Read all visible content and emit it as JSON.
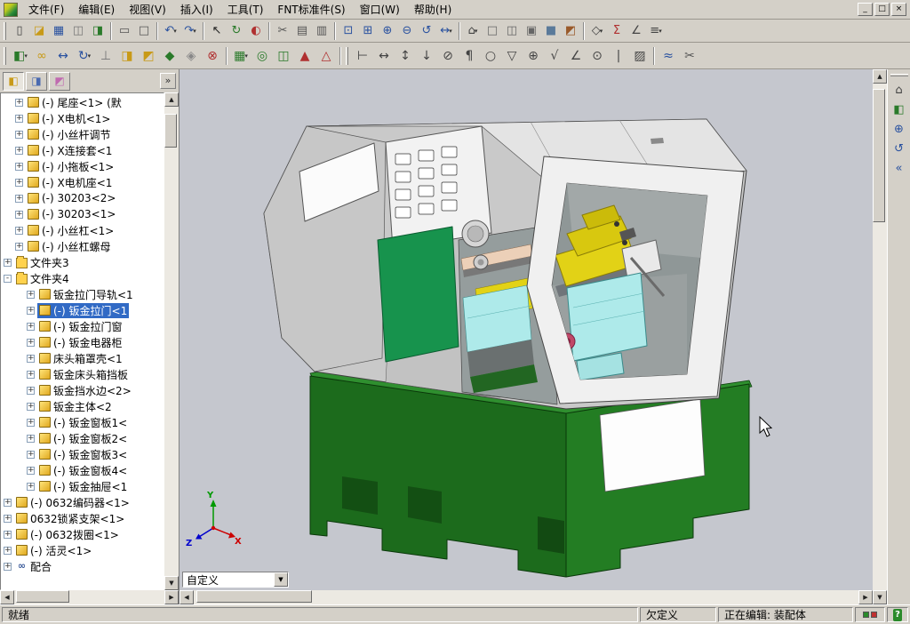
{
  "window": {
    "minimize": "_",
    "restore": "□",
    "close": "×"
  },
  "menu_bar": {
    "items": [
      {
        "id": "file",
        "label": "文件(F)"
      },
      {
        "id": "edit",
        "label": "编辑(E)"
      },
      {
        "id": "view",
        "label": "视图(V)"
      },
      {
        "id": "insert",
        "label": "插入(I)"
      },
      {
        "id": "tools",
        "label": "工具(T)"
      },
      {
        "id": "fnt-standards",
        "label": "FNT标准件(S)"
      },
      {
        "id": "window",
        "label": "窗口(W)"
      },
      {
        "id": "help",
        "label": "帮助(H)"
      }
    ]
  },
  "toolbars": {
    "standard": [
      {
        "grip": 1
      },
      {
        "n": "new-document",
        "g": "▯",
        "c": "#444444"
      },
      {
        "n": "open-document",
        "g": "◪",
        "c": "#c89a18"
      },
      {
        "n": "save",
        "g": "▦",
        "c": "#2a52a0"
      },
      {
        "n": "make-drawing-from-part",
        "g": "◫",
        "c": "#777777"
      },
      {
        "n": "make-assembly-from-part",
        "g": "◨",
        "c": "#2a7a2a"
      },
      {
        "sep": 1
      },
      {
        "n": "print",
        "g": "▭",
        "c": "#555555"
      },
      {
        "n": "print-preview",
        "g": "□",
        "c": "#555555"
      },
      {
        "sep": 1
      },
      {
        "n": "undo",
        "g": "↶",
        "c": "#2a52a0",
        "d": 1
      },
      {
        "n": "redo",
        "g": "↷",
        "c": "#2a52a0",
        "d": 1
      },
      {
        "sep": 1
      },
      {
        "n": "select",
        "g": "↖",
        "c": "#222222"
      },
      {
        "n": "rebuild",
        "g": "↻",
        "c": "#2a7a2a"
      },
      {
        "n": "edit-color",
        "g": "◐",
        "c": "#b03030"
      },
      {
        "sep": 1
      },
      {
        "n": "cut",
        "g": "✂",
        "c": "#555555"
      },
      {
        "n": "copy",
        "g": "▤",
        "c": "#555555"
      },
      {
        "n": "paste",
        "g": "▥",
        "c": "#555555"
      },
      {
        "sep": 1
      },
      {
        "n": "zoom-to-fit",
        "g": "⊡",
        "c": "#2a52a0"
      },
      {
        "n": "zoom-to-area",
        "g": "⊞",
        "c": "#2a52a0"
      },
      {
        "n": "zoom-in-out",
        "g": "⊕",
        "c": "#2a52a0"
      },
      {
        "n": "zoom-out",
        "g": "⊖",
        "c": "#2a52a0"
      },
      {
        "n": "rotate-view",
        "g": "↺",
        "c": "#2a52a0"
      },
      {
        "n": "pan",
        "g": "↔",
        "c": "#2a52a0",
        "d": 1
      },
      {
        "sep": 1
      },
      {
        "n": "standard-views",
        "g": "⌂",
        "c": "#444444",
        "d": 1
      },
      {
        "n": "wireframe",
        "g": "□",
        "c": "#666666"
      },
      {
        "n": "hidden-lines-visible",
        "g": "◫",
        "c": "#666666"
      },
      {
        "n": "hidden-lines-removed",
        "g": "▣",
        "c": "#666666"
      },
      {
        "n": "shaded-with-edges",
        "g": "■",
        "c": "#5a7a9a"
      },
      {
        "n": "section-view",
        "g": "◩",
        "c": "#9a5a2a"
      },
      {
        "sep": 1
      },
      {
        "n": "view-orientation",
        "g": "◇",
        "c": "#444444",
        "d": 1
      },
      {
        "n": "mass-properties",
        "g": "Σ",
        "c": "#b03030"
      },
      {
        "n": "measure",
        "g": "∠",
        "c": "#444444"
      },
      {
        "n": "options",
        "g": "≡",
        "c": "#444444",
        "d": 1
      }
    ],
    "assembly": [
      {
        "grip": 1
      },
      {
        "n": "insert-component",
        "g": "◧",
        "c": "#2a7a2a",
        "d": 1
      },
      {
        "n": "mate",
        "g": "∞",
        "c": "#c89a18"
      },
      {
        "n": "move-component",
        "g": "↔",
        "c": "#2a52a0"
      },
      {
        "n": "rotate-component",
        "g": "↻",
        "c": "#2a52a0",
        "d": 1
      },
      {
        "n": "smart-fasteners",
        "g": "⊥",
        "c": "#777777"
      },
      {
        "n": "hide-show-component",
        "g": "◨",
        "c": "#c89a18"
      },
      {
        "n": "change-suppression-state",
        "g": "◩",
        "c": "#c89a18"
      },
      {
        "n": "edit-component",
        "g": "◆",
        "c": "#2a7a2a"
      },
      {
        "n": "no-external-references",
        "g": "◈",
        "c": "#888888"
      },
      {
        "n": "interference-detection",
        "g": "⊗",
        "c": "#b03030"
      },
      {
        "sep": 1
      },
      {
        "n": "linear-component-pattern",
        "g": "▦",
        "c": "#2a7a2a",
        "d": 1
      },
      {
        "n": "circular-component-pattern",
        "g": "◎",
        "c": "#2a7a2a"
      },
      {
        "n": "mirror-components",
        "g": "◫",
        "c": "#2a7a2a"
      },
      {
        "n": "exploded-view",
        "g": "▲",
        "c": "#b03030"
      },
      {
        "n": "explode-line-sketch",
        "g": "△",
        "c": "#b03030"
      },
      {
        "sep": 1
      },
      {
        "grip": 1
      },
      {
        "n": "smart-dimension",
        "g": "⊢",
        "c": "#444444"
      },
      {
        "n": "horizontal-dimension",
        "g": "↔",
        "c": "#444444"
      },
      {
        "n": "vertical-dimension",
        "g": "↕",
        "c": "#444444"
      },
      {
        "n": "ordinate-dimension",
        "g": "↓",
        "c": "#444444"
      },
      {
        "n": "hole-callout",
        "g": "⊘",
        "c": "#444444"
      },
      {
        "n": "note",
        "g": "¶",
        "c": "#444444"
      },
      {
        "n": "balloon",
        "g": "○",
        "c": "#444444"
      },
      {
        "n": "datum-feature",
        "g": "▽",
        "c": "#444444"
      },
      {
        "n": "geometric-tolerance",
        "g": "⊕",
        "c": "#444444"
      },
      {
        "n": "surface-finish",
        "g": "√",
        "c": "#444444"
      },
      {
        "n": "weld-symbol",
        "g": "∠",
        "c": "#444444"
      },
      {
        "n": "center-mark",
        "g": "⊙",
        "c": "#444444"
      },
      {
        "n": "centerline",
        "g": "|",
        "c": "#444444"
      },
      {
        "n": "area-hatch",
        "g": "▨",
        "c": "#444444"
      },
      {
        "sep": 1
      },
      {
        "n": "spline",
        "g": "≈",
        "c": "#2a52a0"
      },
      {
        "n": "trim-entities",
        "g": "✂",
        "c": "#555555"
      }
    ],
    "view": [
      {
        "grip": 1
      },
      {
        "n": "view-home",
        "g": "⌂",
        "c": "#444444"
      },
      {
        "n": "apply-scene",
        "g": "◧",
        "c": "#2a7a2a"
      },
      {
        "n": "zoom-to-area",
        "g": "⊕",
        "c": "#2a52a0"
      },
      {
        "n": "previous-view",
        "g": "↺",
        "c": "#2a52a0"
      },
      {
        "n": "panel-collapse",
        "g": "«",
        "c": "#2a52a0"
      }
    ]
  },
  "feature_tree": {
    "tabs": [
      {
        "id": "featuremanager",
        "g": "◧",
        "c": "#c89a18"
      },
      {
        "id": "propertymanager",
        "g": "◨",
        "c": "#4a6ab0"
      },
      {
        "id": "configurationmanager",
        "g": "◩",
        "c": "#c06ab0"
      }
    ],
    "collapse_glyph": "»",
    "items": [
      {
        "label": "(-) 尾座<1> (默",
        "icon": "part",
        "exp": "+",
        "ind": 2
      },
      {
        "label": "(-) X电机<1>",
        "icon": "part",
        "exp": "+",
        "ind": 2
      },
      {
        "label": "(-) 小丝杆调节",
        "icon": "part",
        "exp": "+",
        "ind": 2
      },
      {
        "label": "(-) X连接套<1",
        "icon": "part",
        "exp": "+",
        "ind": 2
      },
      {
        "label": "(-) 小拖板<1>",
        "icon": "part",
        "exp": "+",
        "ind": 2
      },
      {
        "label": "(-) X电机座<1",
        "icon": "part",
        "exp": "+",
        "ind": 2
      },
      {
        "label": "(-) 30203<2>",
        "icon": "part",
        "exp": "+",
        "ind": 2
      },
      {
        "label": "(-) 30203<1>",
        "icon": "part",
        "exp": "+",
        "ind": 2
      },
      {
        "label": "(-) 小丝杠<1>",
        "icon": "part",
        "exp": "+",
        "ind": 2
      },
      {
        "label": "(-) 小丝杠螺母",
        "icon": "part",
        "exp": "+",
        "ind": 2
      },
      {
        "label": "文件夹3",
        "icon": "folder",
        "exp": "+",
        "ind": 1
      },
      {
        "label": "文件夹4",
        "icon": "folder",
        "exp": "-",
        "ind": 1
      },
      {
        "label": "钣金拉门导轨<1",
        "icon": "part",
        "exp": "+",
        "ind": 3
      },
      {
        "label": "(-) 钣金拉门<1",
        "icon": "part",
        "exp": "+",
        "ind": 3,
        "sel": true
      },
      {
        "label": "(-) 钣金拉门窗",
        "icon": "part",
        "exp": "+",
        "ind": 3
      },
      {
        "label": "(-) 钣金电器柜",
        "icon": "part",
        "exp": "+",
        "ind": 3
      },
      {
        "label": "床头箱罩壳<1",
        "icon": "part",
        "exp": "+",
        "ind": 3
      },
      {
        "label": "钣金床头箱挡板",
        "icon": "part",
        "exp": "+",
        "ind": 3
      },
      {
        "label": "钣金挡水边<2>",
        "icon": "part",
        "exp": "+",
        "ind": 3
      },
      {
        "label": "钣金主体<2",
        "icon": "part",
        "exp": "+",
        "ind": 3
      },
      {
        "label": "(-) 钣金窗板1<",
        "icon": "part",
        "exp": "+",
        "ind": 3
      },
      {
        "label": "(-) 钣金窗板2<",
        "icon": "part",
        "exp": "+",
        "ind": 3
      },
      {
        "label": "(-) 钣金窗板3<",
        "icon": "part",
        "exp": "+",
        "ind": 3
      },
      {
        "label": "(-) 钣金窗板4<",
        "icon": "part",
        "exp": "+",
        "ind": 3
      },
      {
        "label": "(-) 钣金抽屉<1",
        "icon": "part",
        "exp": "+",
        "ind": 3
      },
      {
        "label": "(-) 0632编码器<1>",
        "icon": "part",
        "exp": "+",
        "ind": 1
      },
      {
        "label": "0632锁紧支架<1>",
        "icon": "part",
        "exp": "+",
        "ind": 1
      },
      {
        "label": "(-) 0632拨圈<1>",
        "icon": "part",
        "exp": "+",
        "ind": 1
      },
      {
        "label": "(-) 活灵<1>",
        "icon": "part",
        "exp": "+",
        "ind": 1
      },
      {
        "label": "配合",
        "icon": "mates",
        "exp": "+",
        "ind": 1
      }
    ]
  },
  "viewport": {
    "custom_view_label": "自定义",
    "triad": {
      "x": "X",
      "y": "Y",
      "z": "Z",
      "x_color": "#cc0000",
      "y_color": "#009900",
      "z_color": "#0000cc"
    },
    "model_colors": {
      "viewport_bg": "#c5c7ce",
      "body_gray": "#c9c9c9",
      "body_light": "#e4e4e4",
      "panel_white": "#f2f2f2",
      "door_green": "#17934d",
      "base_green": "#1c6b1c",
      "base_green_right": "#237d23",
      "base_green_light": "#2f8f2f",
      "turret_yellow": "#e2d216",
      "slide_cyan": "#aeeaea",
      "accent_pink": "#ecd0b8",
      "knob_red": "#c04868"
    }
  },
  "status_bar": {
    "ready": "就绪",
    "underdefined": "欠定义",
    "editing": "正在编辑: 装配体",
    "help": "?"
  }
}
